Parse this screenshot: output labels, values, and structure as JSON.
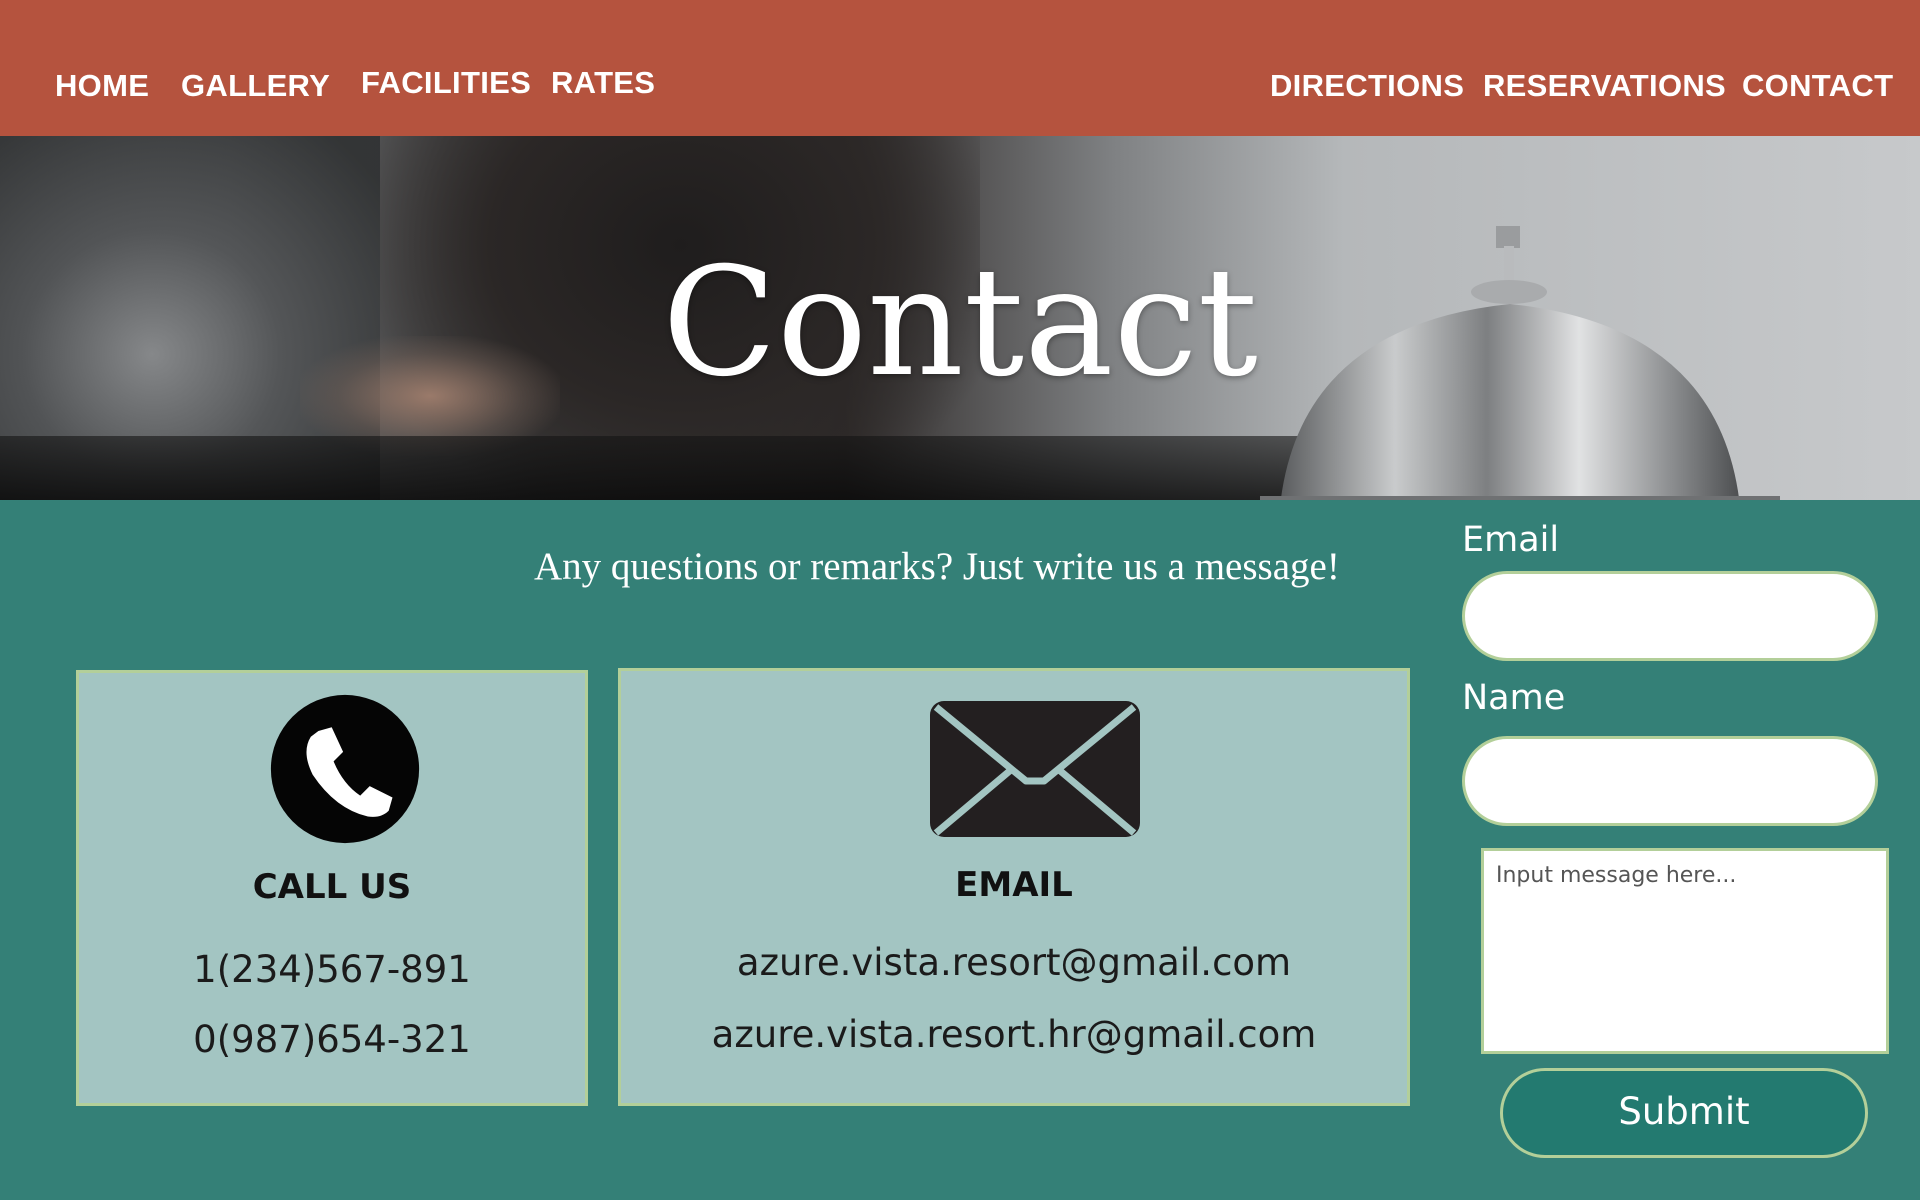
{
  "nav": {
    "left": [
      "HOME",
      "GALLERY",
      "FACILITIES",
      "RATES"
    ],
    "right": [
      "DIRECTIONS",
      "RESERVATIONS",
      "CONTACT"
    ]
  },
  "hero": {
    "title": "Contact"
  },
  "main": {
    "tagline": "Any questions or remarks? Just write us a message!",
    "call_card": {
      "icon": "phone-icon",
      "heading": "CALL US",
      "numbers": [
        "1(234)567-891",
        "0(987)654-321"
      ]
    },
    "email_card": {
      "icon": "envelope-icon",
      "heading": "EMAIL",
      "addresses": [
        "azure.vista.resort@gmail.com",
        "azure.vista.resort.hr@gmail.com"
      ]
    }
  },
  "form": {
    "email_label": "Email",
    "email_value": "",
    "name_label": "Name",
    "name_value": "",
    "message_placeholder": "Input message here...",
    "submit_label": "Submit"
  },
  "colors": {
    "nav_bg": "#b5533e",
    "page_bg": "#348077",
    "card_bg": "#a3c5c2",
    "border": "#b3cf99",
    "submit_bg": "#237a70"
  }
}
